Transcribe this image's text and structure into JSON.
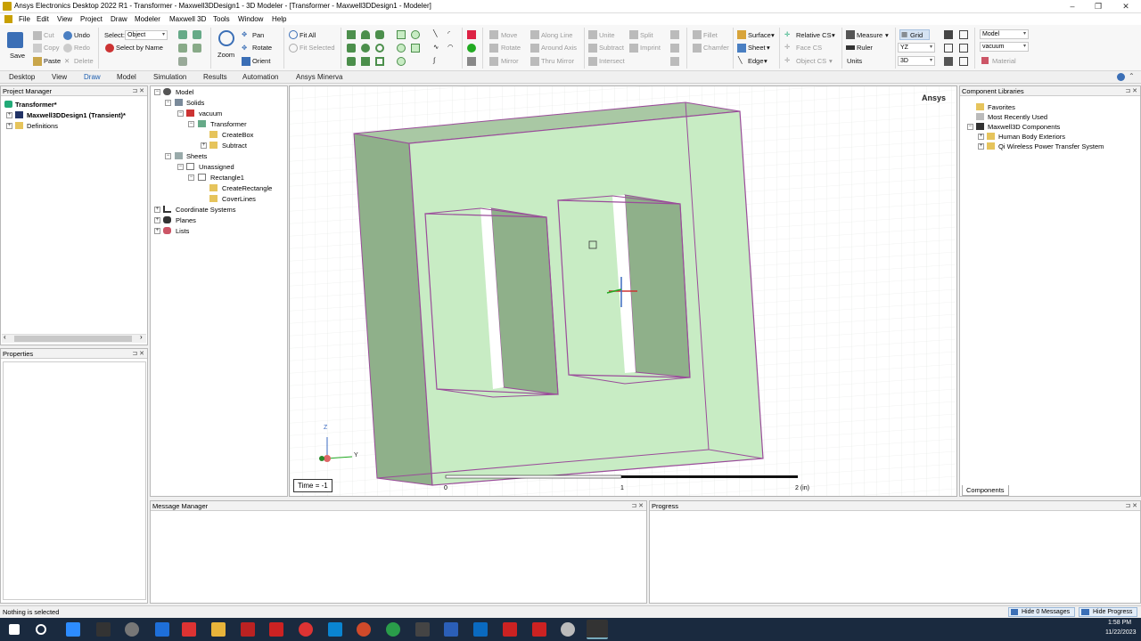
{
  "window": {
    "title": "Ansys Electronics Desktop 2022 R1 - Transformer - Maxwell3DDesign1 - 3D Modeler - [Transformer - Maxwell3DDesign1 - Modeler]"
  },
  "menu": [
    "File",
    "Edit",
    "View",
    "Project",
    "Draw",
    "Modeler",
    "Maxwell 3D",
    "Tools",
    "Window",
    "Help"
  ],
  "ribbon": {
    "save": "Save",
    "cut": "Cut",
    "copy": "Copy",
    "paste": "Paste",
    "undo": "Undo",
    "redo": "Redo",
    "delete": "Delete",
    "select_label": "Select:",
    "select_value": "Object",
    "select_by_name": "Select by Name",
    "zoom": "Zoom",
    "pan": "Pan",
    "rotate": "Rotate",
    "orient": "Orient",
    "fit_all": "Fit All",
    "fit_selected": "Fit Selected",
    "move": "Move",
    "rotate2": "Rotate",
    "mirror": "Mirror",
    "along_line": "Along Line",
    "around_axis": "Around Axis",
    "thru_mirror": "Thru Mirror",
    "unite": "Unite",
    "subtract": "Subtract",
    "intersect": "Intersect",
    "split": "Split",
    "imprint": "Imprint",
    "fillet": "Fillet",
    "chamfer": "Chamfer",
    "surface": "Surface",
    "sheet": "Sheet",
    "edge": "Edge",
    "relative_cs": "Relative CS",
    "face_cs": "Face CS",
    "object_cs": "Object CS",
    "measure": "Measure",
    "ruler": "Ruler",
    "units": "Units",
    "grid": "Grid",
    "plane_value": "YZ",
    "mode_value": "3D",
    "model_value": "Model",
    "material_value": "vacuum",
    "material_button": "Material"
  },
  "tabs": [
    "Desktop",
    "View",
    "Draw",
    "Model",
    "Simulation",
    "Results",
    "Automation",
    "Ansys Minerva"
  ],
  "active_tab": "Draw",
  "project_manager": {
    "title": "Project Manager",
    "project": "Transformer*",
    "design": "Maxwell3DDesign1 (Transient)*",
    "definitions": "Definitions"
  },
  "properties": {
    "title": "Properties"
  },
  "model_tree": {
    "model": "Model",
    "solids": "Solids",
    "vacuum": "vacuum",
    "transformer": "Transformer",
    "create_box": "CreateBox",
    "subtract": "Subtract",
    "sheets": "Sheets",
    "unassigned": "Unassigned",
    "rectangle1": "Rectangle1",
    "create_rectangle": "CreateRectangle",
    "cover_lines": "CoverLines",
    "coordinate_systems": "Coordinate Systems",
    "planes": "Planes",
    "lists": "Lists"
  },
  "viewport": {
    "brand": "Ansys",
    "time_label": "Time = -1",
    "scale_ticks": [
      "0",
      "1",
      "2 (in)"
    ],
    "axis_z": "Z",
    "axis_y": "Y"
  },
  "component_libraries": {
    "title": "Component Libraries",
    "favorites": "Favorites",
    "recent": "Most Recently Used",
    "maxwell3d": "Maxwell3D Components",
    "human_body": "Human Body Exteriors",
    "qi_wireless": "Qi Wireless Power Transfer System",
    "tab": "Components"
  },
  "message_manager": {
    "title": "Message Manager"
  },
  "progress": {
    "title": "Progress"
  },
  "status": {
    "text": "Nothing is selected",
    "hide_messages": "Hide 0 Messages",
    "hide_progress": "Hide Progress"
  },
  "taskbar": {
    "time": "1:58 PM",
    "date": "11/22/2023"
  },
  "colors": {
    "solid_light": "#c8ecc4",
    "solid_dark": "#8fb08a",
    "edge": "#9a4c9a",
    "accent": "#2060b0",
    "taskbar": "#1a2a3f"
  }
}
